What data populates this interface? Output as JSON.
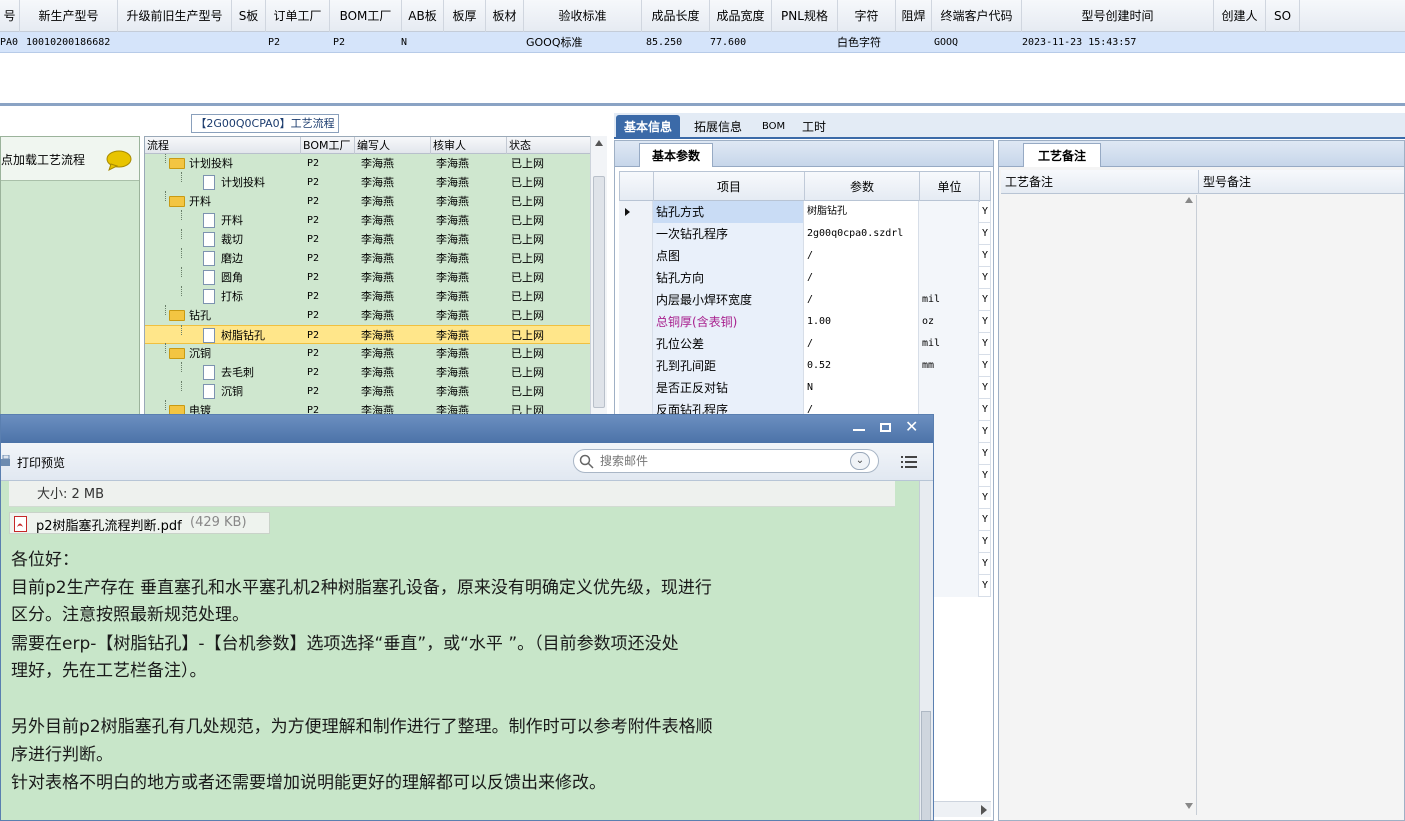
{
  "top_grid": {
    "headers": [
      "号",
      "新生产型号",
      "升级前旧生产型号",
      "S板",
      "订单工厂",
      "BOM工厂",
      "AB板",
      "板厚",
      "板材",
      "验收标准",
      "成品长度",
      "成品宽度",
      "PNL规格",
      "字符",
      "阻焊",
      "终端客户代码",
      "型号创建时间",
      "创建人",
      "SO"
    ],
    "row": {
      "prefix": "PA0",
      "new_model": "10010200186682",
      "order_factory": "P2",
      "bom_factory": "P2",
      "ab_board": "N",
      "acceptance": "GOOQ标准",
      "length": "85.250",
      "width": "77.600",
      "character": "白色字符",
      "customer_code": "GOOQ",
      "created": "2023-11-23 15:43:57"
    }
  },
  "left_strip": {
    "load_text": "点加载工艺流程"
  },
  "tree": {
    "title": "【2G00Q0CPA0】工艺流程",
    "headers": [
      "流程",
      "BOM工厂",
      "编写人",
      "核审人",
      "状态"
    ],
    "rows": [
      {
        "name": "计划投料",
        "level": 0,
        "folder": true,
        "bom": "P2",
        "writer": "李海燕",
        "reviewer": "李海燕",
        "status": "已上网"
      },
      {
        "name": "计划投料",
        "level": 1,
        "folder": false,
        "bom": "P2",
        "writer": "李海燕",
        "reviewer": "李海燕",
        "status": "已上网"
      },
      {
        "name": "开料",
        "level": 0,
        "folder": true,
        "bom": "P2",
        "writer": "李海燕",
        "reviewer": "李海燕",
        "status": "已上网"
      },
      {
        "name": "开料",
        "level": 1,
        "folder": false,
        "bom": "P2",
        "writer": "李海燕",
        "reviewer": "李海燕",
        "status": "已上网"
      },
      {
        "name": "裁切",
        "level": 1,
        "folder": false,
        "bom": "P2",
        "writer": "李海燕",
        "reviewer": "李海燕",
        "status": "已上网"
      },
      {
        "name": "磨边",
        "level": 1,
        "folder": false,
        "bom": "P2",
        "writer": "李海燕",
        "reviewer": "李海燕",
        "status": "已上网"
      },
      {
        "name": "圆角",
        "level": 1,
        "folder": false,
        "bom": "P2",
        "writer": "李海燕",
        "reviewer": "李海燕",
        "status": "已上网"
      },
      {
        "name": "打标",
        "level": 1,
        "folder": false,
        "bom": "P2",
        "writer": "李海燕",
        "reviewer": "李海燕",
        "status": "已上网"
      },
      {
        "name": "钻孔",
        "level": 0,
        "folder": true,
        "bom": "P2",
        "writer": "李海燕",
        "reviewer": "李海燕",
        "status": "已上网"
      },
      {
        "name": "树脂钻孔",
        "level": 1,
        "folder": false,
        "bom": "P2",
        "writer": "李海燕",
        "reviewer": "李海燕",
        "status": "已上网",
        "selected": true
      },
      {
        "name": "沉铜",
        "level": 0,
        "folder": true,
        "bom": "P2",
        "writer": "李海燕",
        "reviewer": "李海燕",
        "status": "已上网"
      },
      {
        "name": "去毛刺",
        "level": 1,
        "folder": false,
        "bom": "P2",
        "writer": "李海燕",
        "reviewer": "李海燕",
        "status": "已上网"
      },
      {
        "name": "沉铜",
        "level": 1,
        "folder": false,
        "bom": "P2",
        "writer": "李海燕",
        "reviewer": "李海燕",
        "status": "已上网"
      },
      {
        "name": "电镀",
        "level": 0,
        "folder": true,
        "bom": "P2",
        "writer": "李海燕",
        "reviewer": "李海燕",
        "status": "已上网"
      }
    ]
  },
  "tabs": [
    "基本信息",
    "拓展信息",
    "BOM",
    "工时"
  ],
  "params": {
    "subtab": "基本参数",
    "headers": [
      "项目",
      "参数",
      "单位"
    ],
    "rows": [
      {
        "name": "钻孔方式",
        "value": "树脂钻孔",
        "unit": "",
        "flag": "Y",
        "current": true
      },
      {
        "name": "一次钻孔程序",
        "value": "2g00q0cpa0.szdrl",
        "unit": "",
        "flag": "Y"
      },
      {
        "name": "点图",
        "value": "/",
        "unit": "",
        "flag": "Y"
      },
      {
        "name": "钻孔方向",
        "value": "/",
        "unit": "",
        "flag": "Y"
      },
      {
        "name": "内层最小焊环宽度",
        "value": "/",
        "unit": "mil",
        "flag": "Y"
      },
      {
        "name": "总铜厚(含表铜)",
        "value": "1.00",
        "unit": "oz",
        "flag": "Y",
        "highlight": true
      },
      {
        "name": "孔位公差",
        "value": "/",
        "unit": "mil",
        "flag": "Y"
      },
      {
        "name": "孔到孔间距",
        "value": "0.52",
        "unit": "mm",
        "flag": "Y"
      },
      {
        "name": "是否正反对钻",
        "value": "N",
        "unit": "",
        "flag": "Y"
      },
      {
        "name": "反面钻孔程序",
        "value": "/",
        "unit": "",
        "flag": "Y"
      }
    ],
    "extra_flags": [
      "Y",
      "Y",
      "Y",
      "Y",
      "Y",
      "Y",
      "Y",
      "Y"
    ]
  },
  "notes": {
    "tab": "工艺备注",
    "col1": "工艺备注",
    "col2": "型号备注"
  },
  "mail": {
    "toolbar_label": "打印预览",
    "search_placeholder": "搜索邮件",
    "size_text": "大小: 2 MB",
    "attachment_name": "p2树脂塞孔流程判断.pdf",
    "attachment_size": "(429 KB)",
    "lines": [
      "各位好：",
      "          目前p2生产存在 垂直塞孔和水平塞孔机2种树脂塞孔设备，原来没有明确定义优先级，现进行",
      "区分。注意按照最新规范处理。",
      "          需要在erp-【树脂钻孔】-【台机参数】选项选择“垂直”，或“水平 ”。（目前参数项还没处",
      "理好，先在工艺栏备注）。",
      "",
      "          另外目前p2树脂塞孔有几处规范，为方便理解和制作进行了整理。制作时可以参考附件表格顺",
      "序进行判断。",
      "          针对表格不明白的地方或者还需要增加说明能更好的理解都可以反馈出来修改。"
    ]
  }
}
